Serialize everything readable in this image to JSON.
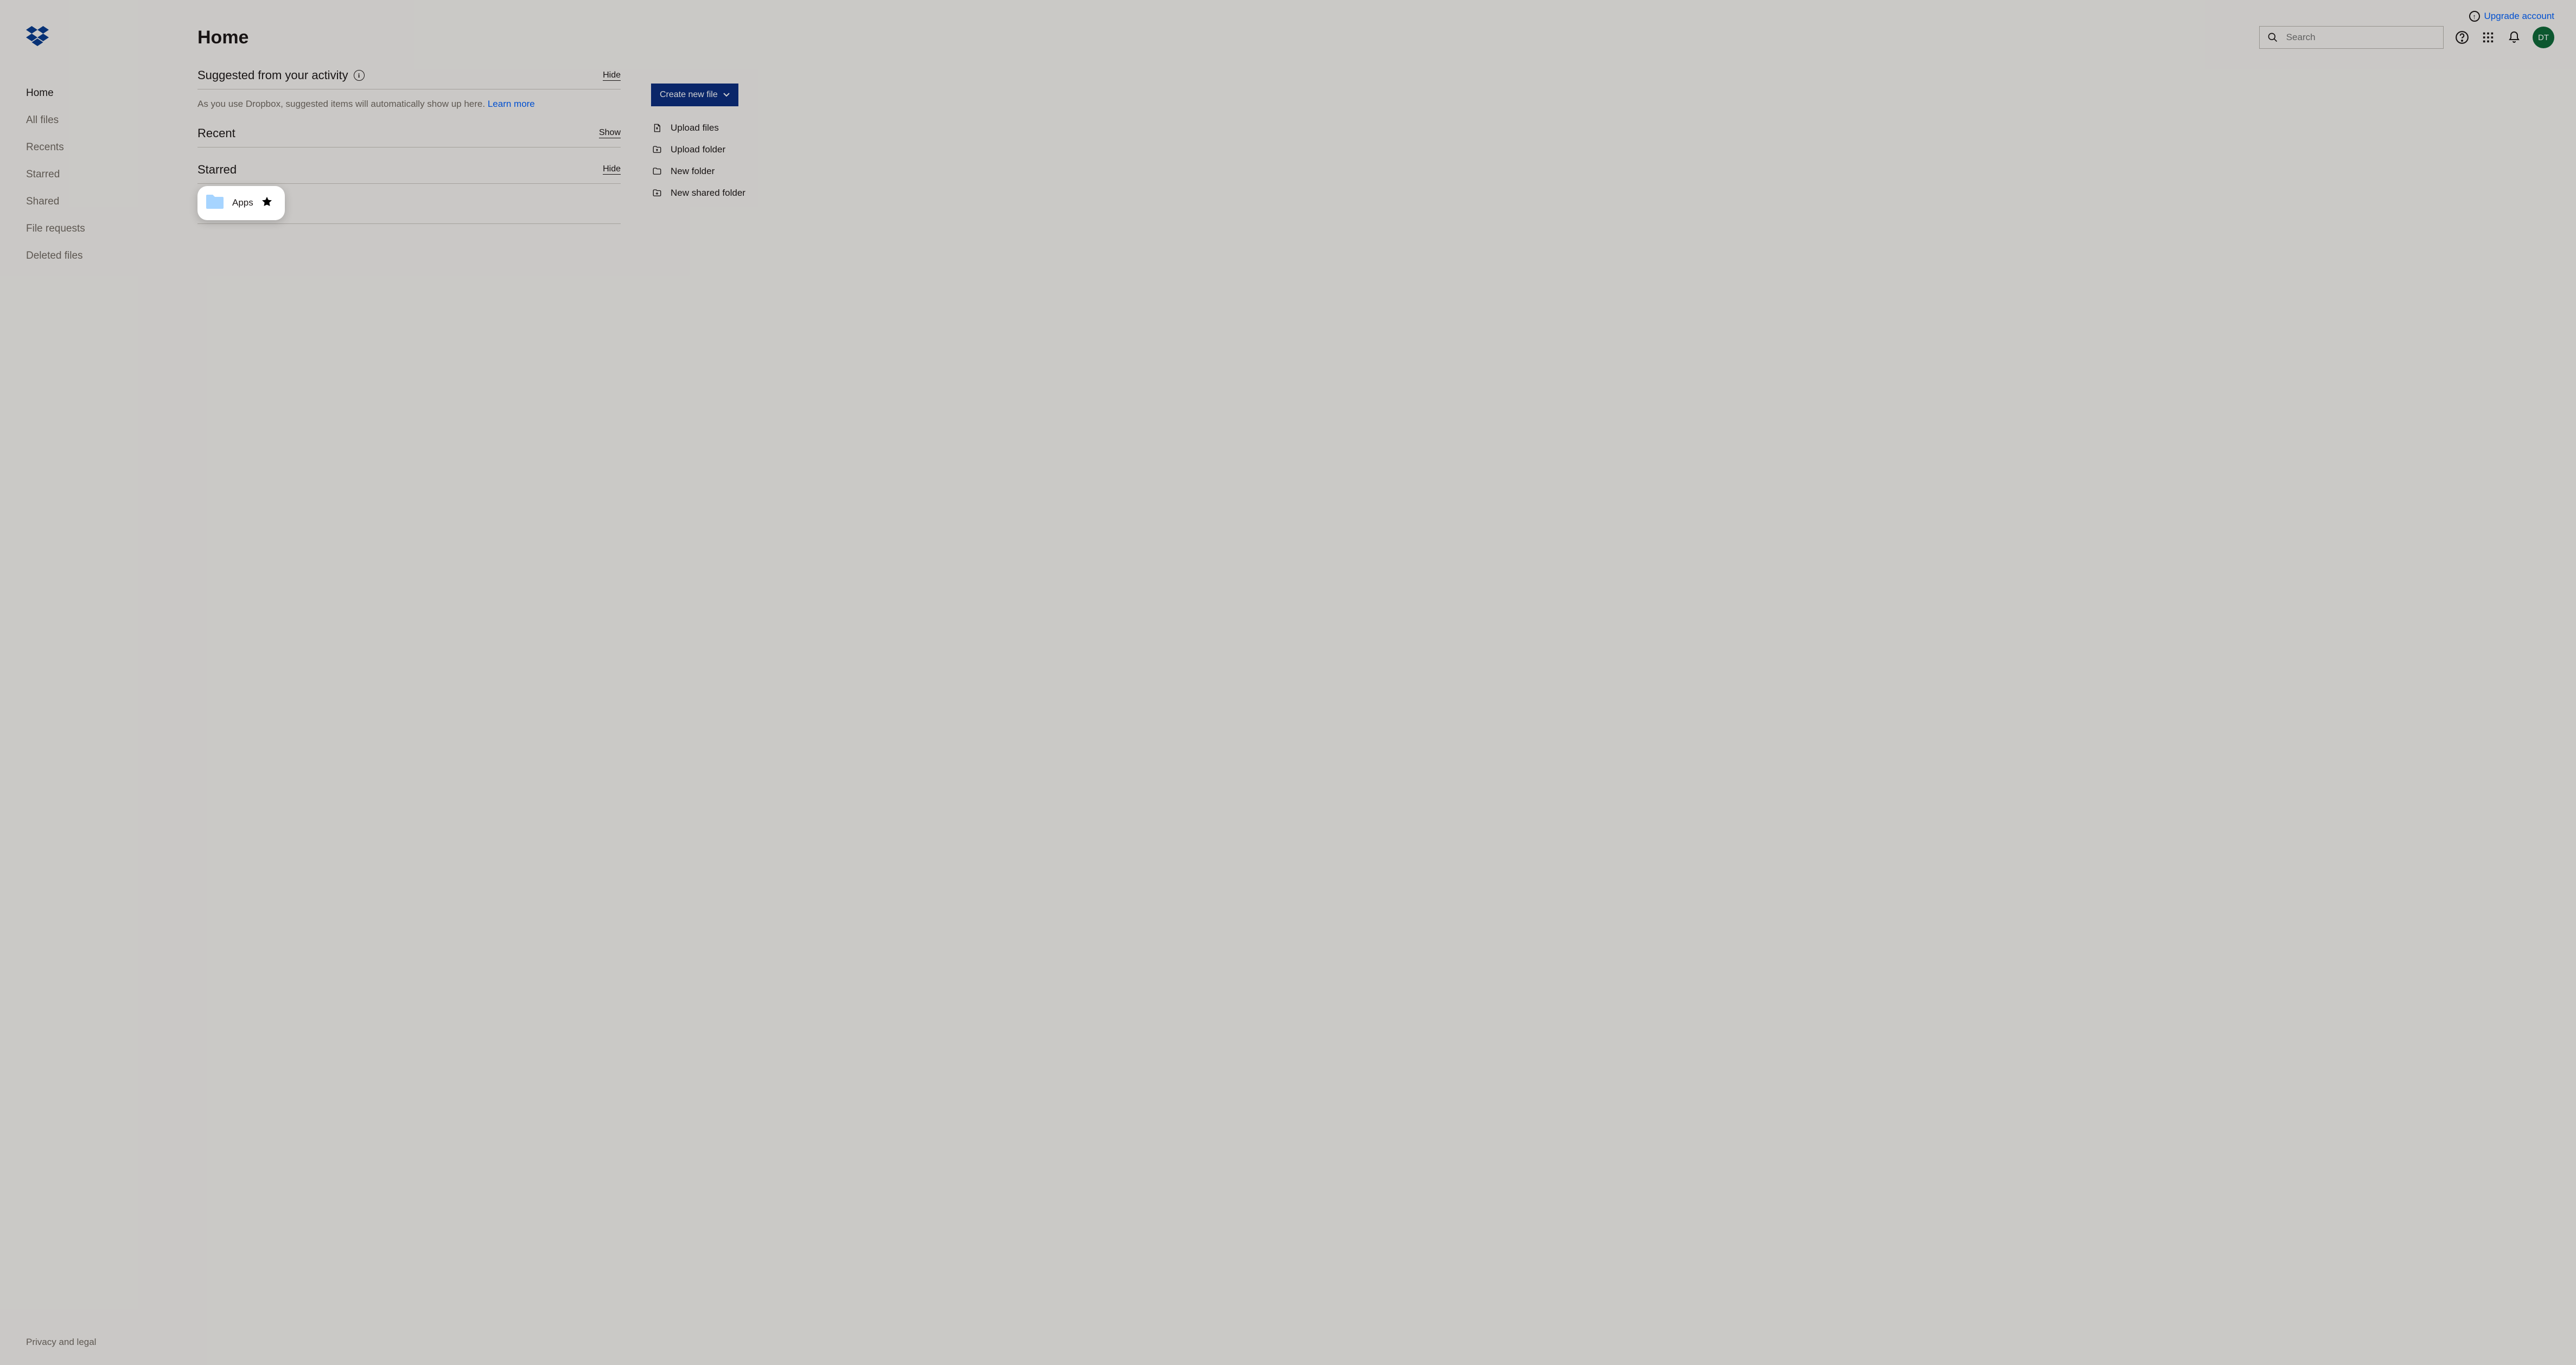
{
  "sidebar": {
    "nav": [
      {
        "label": "Home",
        "active": true
      },
      {
        "label": "All files",
        "active": false
      },
      {
        "label": "Recents",
        "active": false
      },
      {
        "label": "Starred",
        "active": false
      },
      {
        "label": "Shared",
        "active": false
      },
      {
        "label": "File requests",
        "active": false
      },
      {
        "label": "Deleted files",
        "active": false
      }
    ],
    "footer": "Privacy and legal"
  },
  "header": {
    "upgrade": "Upgrade account",
    "title": "Home",
    "search_placeholder": "Search",
    "avatar_initials": "DT"
  },
  "sections": {
    "suggested": {
      "title": "Suggested from your activity",
      "toggle": "Hide",
      "body": "As you use Dropbox, suggested items will automatically show up here. ",
      "learn_more": "Learn more"
    },
    "recent": {
      "title": "Recent",
      "toggle": "Show"
    },
    "starred": {
      "title": "Starred",
      "toggle": "Hide",
      "item_name": "Apps"
    }
  },
  "actions": {
    "primary": "Create new file",
    "list": [
      {
        "label": "Upload files",
        "icon": "file-upload"
      },
      {
        "label": "Upload folder",
        "icon": "folder-upload"
      },
      {
        "label": "New folder",
        "icon": "folder"
      },
      {
        "label": "New shared folder",
        "icon": "folder-plus"
      }
    ]
  }
}
